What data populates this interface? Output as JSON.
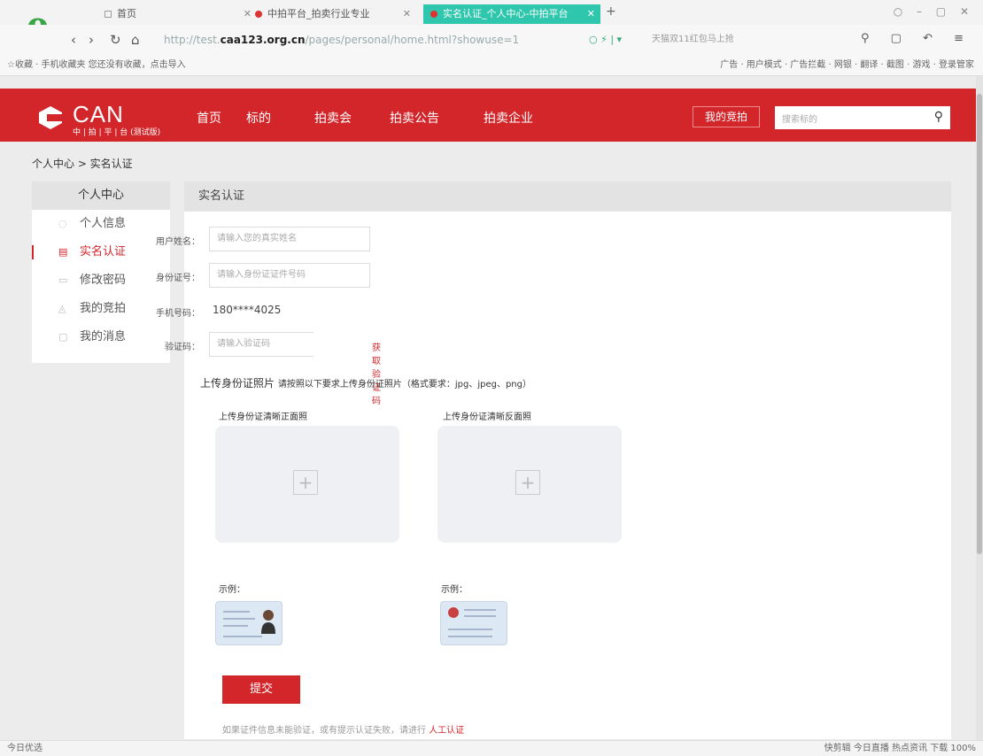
{
  "browser": {
    "tabs": [
      {
        "title": "首页"
      },
      {
        "title": "中拍平台_拍卖行业专业"
      },
      {
        "title": "实名认证_个人中心-中拍平台"
      }
    ],
    "url_prefix": "http://test.",
    "url_host": "caa123.org.cn",
    "url_path": "/pages/personal/home.html?showuse=1",
    "search_placeholder": "天猫双11红包马上抢",
    "bookmarks_left": "☆收藏 · 手机收藏夹  您还没有收藏，点击导入",
    "bookmarks_right": "广告 · 用户模式 · 广告拦截 · 网银 · 翻译 · 截图 · 游戏 · 登录管家"
  },
  "header": {
    "logo_text": "CAN",
    "logo_sub": "中 | 拍 | 平 | 台 (测试版)",
    "nav": [
      "首页",
      "标的",
      "拍卖会",
      "拍卖公告",
      "拍卖企业"
    ],
    "my_auction": "我的竞拍",
    "search_placeholder": "搜索标的"
  },
  "breadcrumb": "个人中心 > 实名认证",
  "sidebar": {
    "title": "个人中心",
    "items": [
      {
        "label": "个人信息",
        "icon": "user-icon",
        "active": false
      },
      {
        "label": "实名认证",
        "icon": "id-card-icon",
        "active": true
      },
      {
        "label": "修改密码",
        "icon": "lock-icon",
        "active": false
      },
      {
        "label": "我的竞拍",
        "icon": "gavel-icon",
        "active": false
      },
      {
        "label": "我的消息",
        "icon": "message-icon",
        "active": false
      }
    ]
  },
  "panel": {
    "title": "实名认证",
    "fields": {
      "name_label": "用户姓名：",
      "name_placeholder": "请输入您的真实姓名",
      "id_label": "身份证号：",
      "id_placeholder": "请输入身份证证件号码",
      "phone_label": "手机号码：",
      "phone_value": "180****4025",
      "code_label": "验证码：",
      "code_placeholder": "请输入验证码",
      "code_button": "获取验证码"
    },
    "upload": {
      "title": "上传身份证照片",
      "note": "请按照以下要求上传身份证照片（格式要求：jpg、jpeg、png）",
      "front_label": "上传身份证清晰正面照",
      "back_label": "上传身份证清晰反面照",
      "example_label": "示例："
    },
    "submit": "提交",
    "tip": "如果证件信息未能验证，或有提示认证失败，请进行",
    "tip_link": "人工认证"
  },
  "status": {
    "left": "今日优选",
    "right": "快剪辑  今日直播  热点资讯  下载  100%"
  }
}
